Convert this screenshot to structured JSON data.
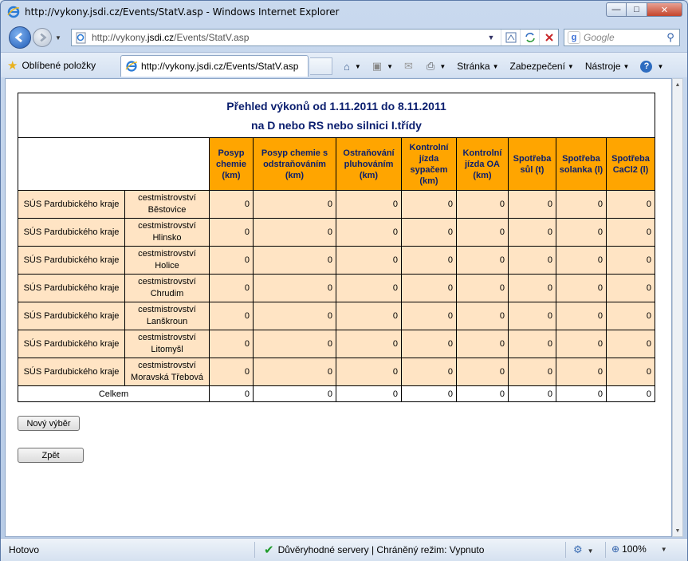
{
  "window": {
    "title": "http://vykony.jsdi.cz/Events/StatV.asp - Windows Internet Explorer",
    "min_label": "—",
    "max_label": "□",
    "close_label": "✕"
  },
  "address": {
    "url_prefix": "http://vykony.",
    "url_domain": "jsdi.cz",
    "url_suffix": "/Events/StatV.asp"
  },
  "search": {
    "placeholder": "Google"
  },
  "favorites": {
    "label": "Oblíbené položky"
  },
  "tab": {
    "label": "http://vykony.jsdi.cz/Events/StatV.asp"
  },
  "commandbar": {
    "page": "Stránka",
    "safety": "Zabezpečení",
    "tools": "Nástroje"
  },
  "report": {
    "title1": "Přehled výkonů od 1.11.2011 do 8.11.2011",
    "title2": "na D nebo RS nebo silnici I.třídy",
    "columns": [
      "Posyp chemie (km)",
      "Posyp chemie s odstraňováním (km)",
      "Ostraňování pluhováním (km)",
      "Kontrolní jízda sypačem (km)",
      "Kontrolní jízda OA (km)",
      "Spotřeba sůl (t)",
      "Spotřeba solanka (l)",
      "Spotřeba CaCl2 (l)"
    ],
    "rows": [
      {
        "org": "SÚS Pardubického kraje",
        "unit_line1": "cestmistrovství",
        "unit_line2": "Běstovice",
        "values": [
          "0",
          "0",
          "0",
          "0",
          "0",
          "0",
          "0",
          "0"
        ]
      },
      {
        "org": "SÚS Pardubického kraje",
        "unit_line1": "cestmistrovství",
        "unit_line2": "Hlinsko",
        "values": [
          "0",
          "0",
          "0",
          "0",
          "0",
          "0",
          "0",
          "0"
        ]
      },
      {
        "org": "SÚS Pardubického kraje",
        "unit_line1": "cestmistrovství",
        "unit_line2": "Holice",
        "values": [
          "0",
          "0",
          "0",
          "0",
          "0",
          "0",
          "0",
          "0"
        ]
      },
      {
        "org": "SÚS Pardubického kraje",
        "unit_line1": "cestmistrovství",
        "unit_line2": "Chrudim",
        "values": [
          "0",
          "0",
          "0",
          "0",
          "0",
          "0",
          "0",
          "0"
        ]
      },
      {
        "org": "SÚS Pardubického kraje",
        "unit_line1": "cestmistrovství",
        "unit_line2": "Lanškroun",
        "values": [
          "0",
          "0",
          "0",
          "0",
          "0",
          "0",
          "0",
          "0"
        ]
      },
      {
        "org": "SÚS Pardubického kraje",
        "unit_line1": "cestmistrovství",
        "unit_line2": "Litomyšl",
        "values": [
          "0",
          "0",
          "0",
          "0",
          "0",
          "0",
          "0",
          "0"
        ]
      },
      {
        "org": "SÚS Pardubického kraje",
        "unit_line1": "cestmistrovství",
        "unit_line2": "Moravská Třebová",
        "values": [
          "0",
          "0",
          "0",
          "0",
          "0",
          "0",
          "0",
          "0"
        ]
      }
    ],
    "total_label": "Celkem",
    "total_values": [
      "0",
      "0",
      "0",
      "0",
      "0",
      "0",
      "0",
      "0"
    ]
  },
  "buttons": {
    "new_selection": "Nový výběr",
    "back": "Zpět"
  },
  "status": {
    "text": "Hotovo",
    "trusted": "Důvěryhodné servery | Chráněný režim: Vypnuto",
    "zoom": "100%"
  },
  "colors": {
    "header_orange": "#ffa500",
    "row_bisque": "#ffe4c4",
    "title_navy": "#0a1e6e"
  }
}
